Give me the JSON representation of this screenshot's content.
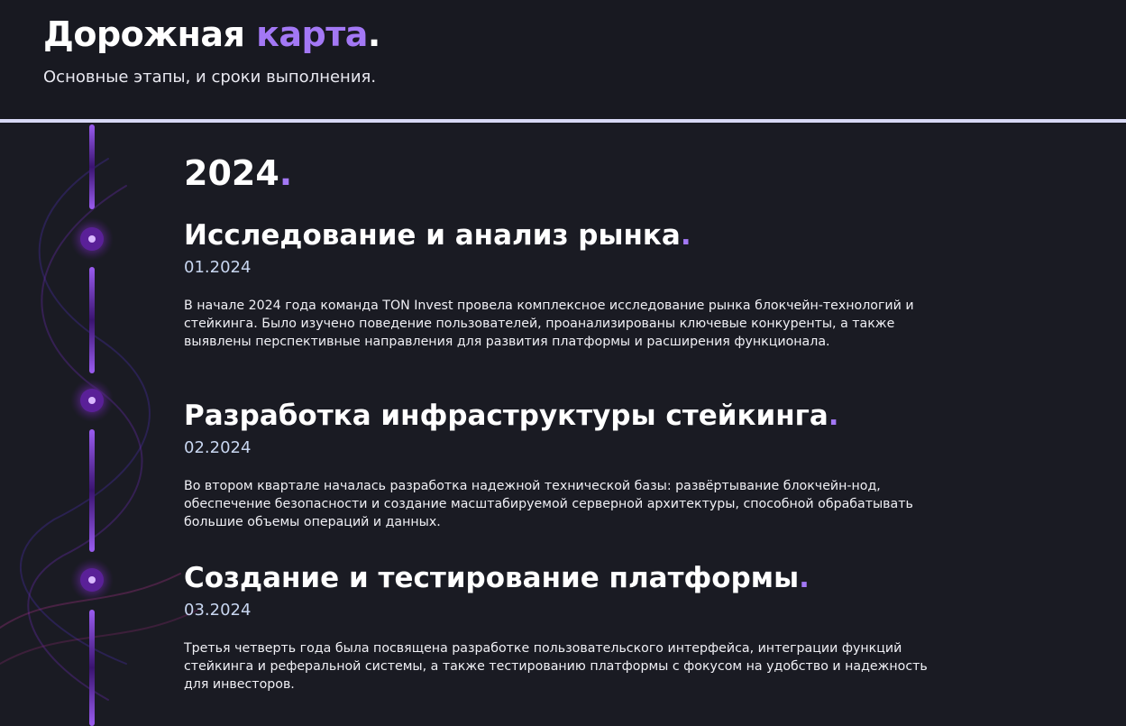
{
  "header": {
    "title_main": "Дорожная ",
    "title_accent": "карта",
    "title_dot": ".",
    "subtitle": "Основные этапы, и сроки выполнения."
  },
  "roadmap": {
    "year": "2024",
    "year_dot": ".",
    "items": [
      {
        "title": "Исследование и анализ рынка",
        "dot": ".",
        "date": "01.2024",
        "text": "В начале 2024 года команда TON Invest провела комплексное исследование рынка блокчейн-технологий и стейкинга. Было изучено поведение пользователей, проанализированы ключевые конкуренты, а также выявлены перспективные направления для развития платформы и расширения функционала."
      },
      {
        "title": "Разработка инфраструктуры стейкинга",
        "dot": ".",
        "date": "02.2024",
        "text": "Во втором квартале началась разработка надежной технической базы: развёртывание блокчейн-нод, обеспечение безопасности и создание масштабируемой серверной архитектуры, способной обрабатывать большие объемы операций и данных."
      },
      {
        "title": "Создание и тестирование платформы",
        "dot": ".",
        "date": "03.2024",
        "text": "Третья четверть года была посвящена разработке пользовательского интерфейса, интеграции функций стейкинга и реферальной системы, а также тестированию платформы с фокусом на удобство и надежность для инвесторов."
      }
    ]
  },
  "colors": {
    "background": "#1a1b23",
    "accent": "#a378f5",
    "divider": "#d8d9f5",
    "timeline_bar": "#7b3fd9"
  }
}
